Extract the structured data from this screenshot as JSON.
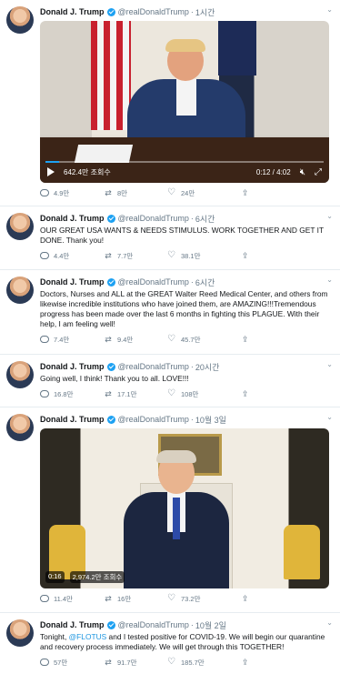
{
  "author": {
    "name": "Donald J. Trump",
    "handle": "@realDonaldTrump"
  },
  "tweets": [
    {
      "time": "1시간",
      "media": {
        "type": "video",
        "views": "642.4만 조회수",
        "time": "0:12 / 4:02",
        "progress": 0.05
      },
      "replies": "4.9만",
      "retweets": "8만",
      "likes": "24만"
    },
    {
      "time": "6시간",
      "text": "OUR GREAT USA WANTS & NEEDS STIMULUS. WORK TOGETHER AND GET IT DONE. Thank you!",
      "replies": "4.4만",
      "retweets": "7.7만",
      "likes": "38.1만"
    },
    {
      "time": "6시간",
      "text": "Doctors, Nurses and ALL at the GREAT Walter Reed Medical Center, and others from likewise incredible institutions who have joined them, are AMAZING!!!Tremendous progress has been made over the last 6 months in fighting this PLAGUE. With their help, I am feeling well!",
      "replies": "7.4만",
      "retweets": "9.4만",
      "likes": "45.7만"
    },
    {
      "time": "20시간",
      "text": "Going well, I think! Thank you to all. LOVE!!!",
      "replies": "16.8만",
      "retweets": "17.1만",
      "likes": "108만"
    },
    {
      "time": "10월 3일",
      "media": {
        "type": "video",
        "duration": "0:16",
        "views": "2,974.2만 조회수"
      },
      "replies": "11.4만",
      "retweets": "16만",
      "likes": "73.2만"
    },
    {
      "time": "10월 2일",
      "text_pre": "Tonight, ",
      "mention": "@FLOTUS",
      "text_post": " and I tested positive for COVID-19. We will begin our quarantine and recovery process immediately. We will get through this TOGETHER!",
      "replies": "57만",
      "retweets": "91.7만",
      "likes": "185.7만"
    }
  ],
  "colors": {
    "accent": "#1da1f2",
    "muted": "#657786",
    "border": "#e6ecf0"
  }
}
